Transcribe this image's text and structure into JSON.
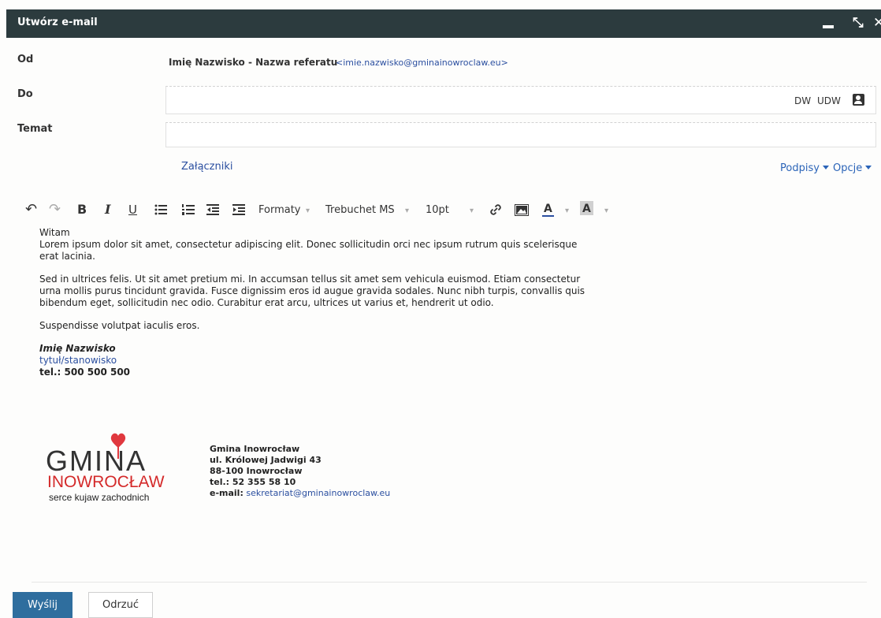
{
  "window": {
    "title": "Utwórz e-mail",
    "minimize_glyph": "",
    "restore_glyph": "⤡",
    "close_glyph": "✕"
  },
  "form": {
    "from_label": "Od",
    "from_name": "Imię Nazwisko - Nazwa referatu",
    "from_address": "<imie.nazwisko@gminainowroclaw.eu>",
    "to_label": "Do",
    "to_value": "",
    "cc_label": "DW",
    "bcc_label": "UDW",
    "subject_label": "Temat",
    "subject_value": "",
    "attachments_label": "Załączniki",
    "signatures_label": "Podpisy",
    "options_label": "Opcje"
  },
  "toolbar": {
    "undo_glyph": "↶",
    "redo_glyph": "↷",
    "bold_glyph": "B",
    "italic_glyph": "I",
    "underline_glyph": "U",
    "formats_label": "Formaty",
    "font_family": "Trebuchet MS",
    "font_size": "10pt",
    "text_color_glyph": "A",
    "bg_color_glyph": "A",
    "icon_color_text": "#2b4fa0",
    "icon_color_bg": "#cccccc"
  },
  "body": {
    "greeting": "Witam",
    "para1": "Lorem ipsum dolor sit amet, consectetur adipiscing elit. Donec sollicitudin orci nec ipsum rutrum quis scelerisque erat lacinia.",
    "para2": "Sed in ultrices felis. Ut sit amet pretium mi. In accumsan tellus sit amet sem vehicula euismod. Etiam consectetur urna mollis purus tincidunt gravida. Fusce dignissim eros id augue gravida sodales. Nunc nibh turpis, convallis quis bibendum eget, sollicitudin nec odio. Curabitur erat arcu, ultrices ut varius et, hendrerit ut odio.",
    "para3": "Suspendisse volutpat iaculis eros.",
    "signature": {
      "name": "Imię Nazwisko",
      "position": "tytuł/stanowisko",
      "phone": "tel.: 500 500 500"
    },
    "logo": {
      "line1": "GMINA",
      "line2": "INOWROCŁAW",
      "line3": "serce kujaw zachodnich",
      "heart_color": "#e0383e"
    },
    "address": {
      "org": "Gmina Inowrocław",
      "street": "ul. Królowej Jadwigi 43",
      "city": "88-100 Inowrocław",
      "phone": "tel.: 52 355 58 10",
      "email_label": "e-mail:",
      "email": "sekretariat@gminainowroclaw.eu"
    }
  },
  "actions": {
    "send_label": "Wyślij",
    "discard_label": "Odrzuć"
  },
  "colors": {
    "titlebar": "#2c3b3e",
    "link": "#2b4fa0",
    "send_button": "#2f6e9e"
  }
}
